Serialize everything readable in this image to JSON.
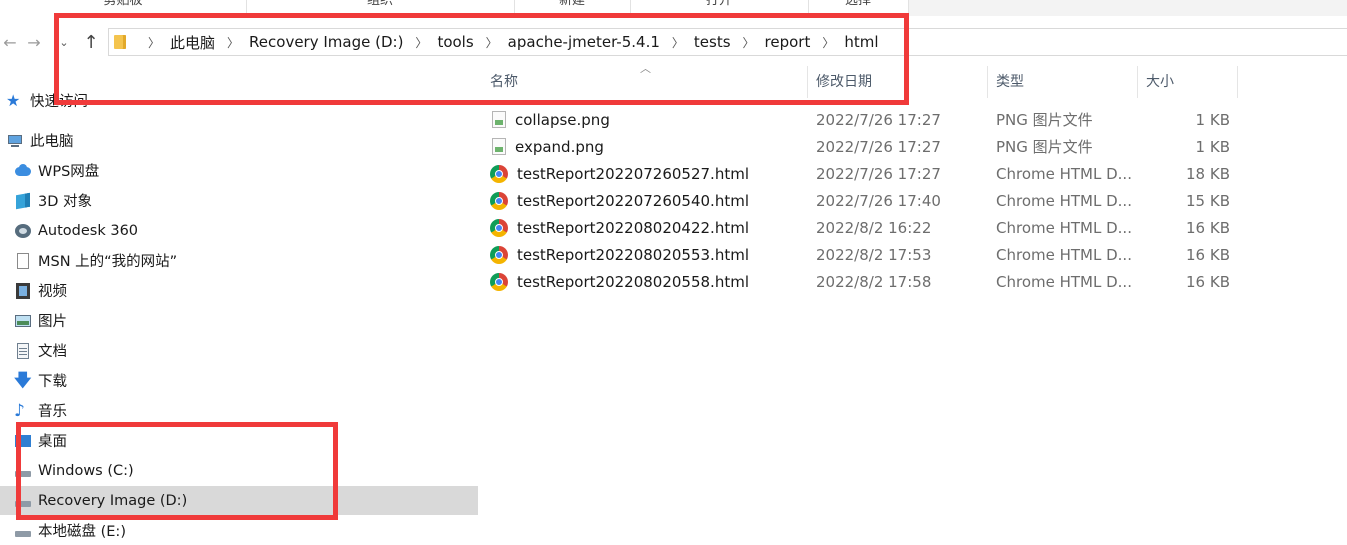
{
  "ribbon": {
    "groups": [
      "剪贴板",
      "组织",
      "新建",
      "打开",
      "选择"
    ]
  },
  "breadcrumb": [
    "此电脑",
    "Recovery Image (D:)",
    "tools",
    "apache-jmeter-5.4.1",
    "tests",
    "report",
    "html"
  ],
  "nav_pane": {
    "items": [
      {
        "label": "快速访问",
        "icon": "star-icon"
      },
      {
        "label": "此电脑",
        "icon": "computer-icon"
      },
      {
        "label": "WPS网盘",
        "icon": "cloud-icon"
      },
      {
        "label": "3D 对象",
        "icon": "cube-icon"
      },
      {
        "label": "Autodesk 360",
        "icon": "autodesk-icon"
      },
      {
        "label": "MSN 上的“我的网站”",
        "icon": "page-icon"
      },
      {
        "label": "视频",
        "icon": "film-icon"
      },
      {
        "label": "图片",
        "icon": "picture-icon"
      },
      {
        "label": "文档",
        "icon": "document-icon"
      },
      {
        "label": "下载",
        "icon": "download-arrow-icon"
      },
      {
        "label": "音乐",
        "icon": "music-note-icon"
      },
      {
        "label": "桌面",
        "icon": "desktop-icon"
      },
      {
        "label": "Windows (C:)",
        "icon": "drive-icon"
      },
      {
        "label": "Recovery Image (D:)",
        "icon": "drive-icon"
      },
      {
        "label": "本地磁盘 (E:)",
        "icon": "drive-icon"
      }
    ],
    "selected": "Recovery Image (D:)"
  },
  "columns": {
    "name": "名称",
    "date": "修改日期",
    "type": "类型",
    "size": "大小"
  },
  "files": [
    {
      "name": "collapse.png",
      "date": "2022/7/26 17:27",
      "type": "PNG 图片文件",
      "size": "1 KB",
      "icon": "png-file-icon"
    },
    {
      "name": "expand.png",
      "date": "2022/7/26 17:27",
      "type": "PNG 图片文件",
      "size": "1 KB",
      "icon": "png-file-icon"
    },
    {
      "name": "testReport202207260527.html",
      "date": "2022/7/26 17:27",
      "type": "Chrome HTML D...",
      "size": "18 KB",
      "icon": "chrome-icon"
    },
    {
      "name": "testReport202207260540.html",
      "date": "2022/7/26 17:40",
      "type": "Chrome HTML D...",
      "size": "15 KB",
      "icon": "chrome-icon"
    },
    {
      "name": "testReport202208020422.html",
      "date": "2022/8/2 16:22",
      "type": "Chrome HTML D...",
      "size": "16 KB",
      "icon": "chrome-icon"
    },
    {
      "name": "testReport202208020553.html",
      "date": "2022/8/2 17:53",
      "type": "Chrome HTML D...",
      "size": "16 KB",
      "icon": "chrome-icon"
    },
    {
      "name": "testReport202208020558.html",
      "date": "2022/8/2 17:58",
      "type": "Chrome HTML D...",
      "size": "16 KB",
      "icon": "chrome-icon"
    }
  ],
  "colors": {
    "highlight": "#f03a3a",
    "selected_bg": "#d9d9d9"
  }
}
